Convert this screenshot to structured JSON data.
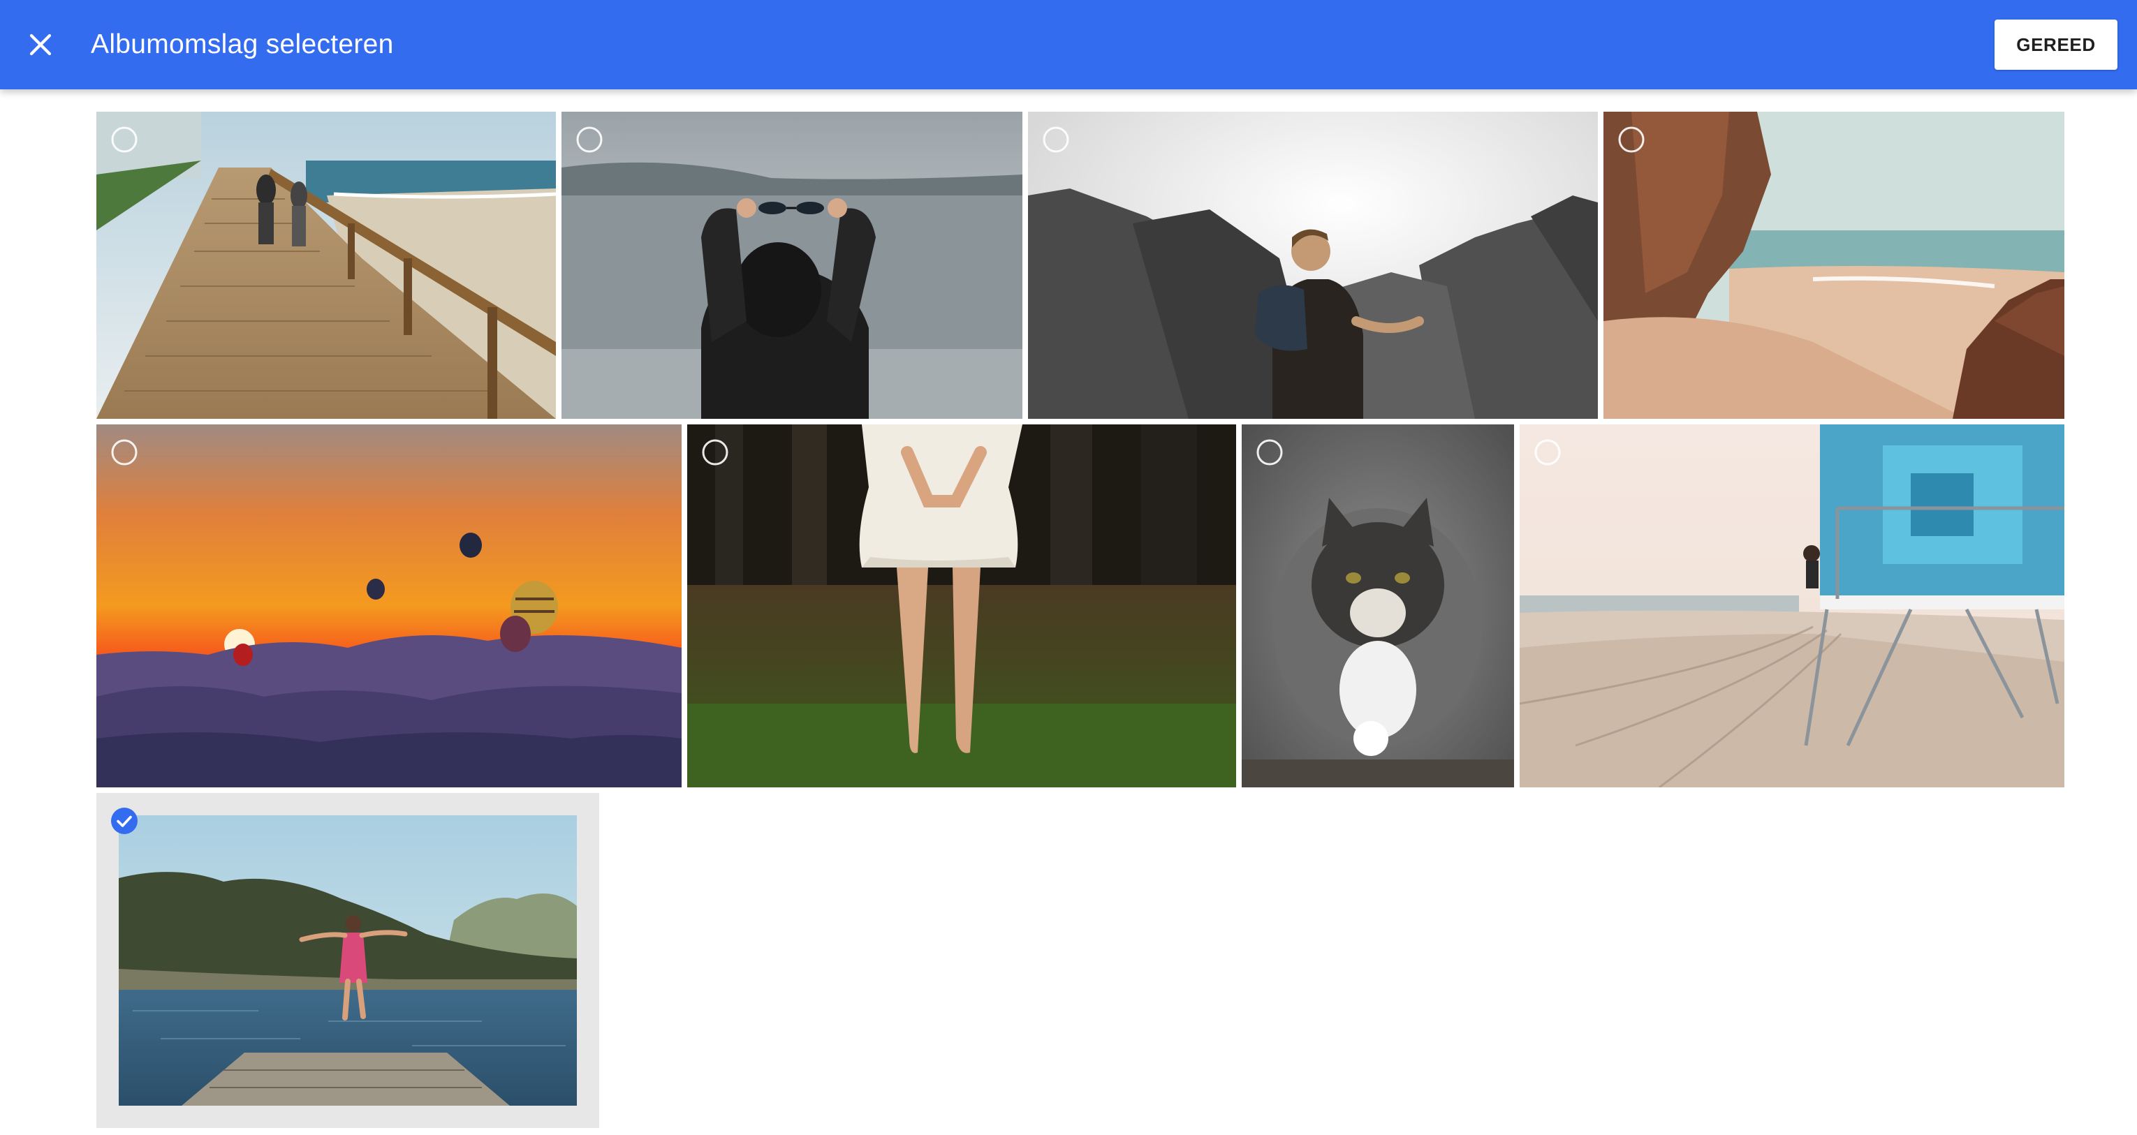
{
  "header": {
    "title": "Albumomslag selecteren",
    "done_label": "GEREED",
    "close_icon": "close-icon",
    "color": "#346cf0"
  },
  "photos": [
    {
      "subject": "boardwalk",
      "selected": false
    },
    {
      "subject": "sunglasses",
      "selected": false
    },
    {
      "subject": "rocks-hiker",
      "selected": false
    },
    {
      "subject": "beach-cliffs",
      "selected": false
    },
    {
      "subject": "balloons-sunset",
      "selected": false
    },
    {
      "subject": "forest-dress",
      "selected": false
    },
    {
      "subject": "cat",
      "selected": false
    },
    {
      "subject": "lifeguard-tower",
      "selected": false
    },
    {
      "subject": "lake-jump",
      "selected": true
    }
  ],
  "colors": {
    "selected_background": "#e7e7e7",
    "check_selected": "#346cf0",
    "check_unselected": "#ffffff"
  }
}
